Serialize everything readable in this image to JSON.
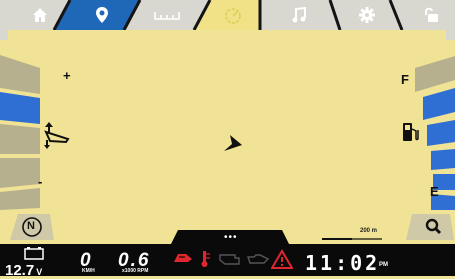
{
  "colors": {
    "map_bg": "#f1e395",
    "tab_active": "#1f67b7",
    "gauge_blue": "#2f6fd3",
    "gauge_gray": "#b7b08f",
    "bar_bg": "#0a0a0a",
    "warn_red": "#e0262f",
    "icon_yellow": "#d9cf56"
  },
  "nav": {
    "tabs": [
      {
        "icon": "home-icon",
        "active": false
      },
      {
        "icon": "location-pin-icon",
        "active": true
      },
      {
        "icon": "ruler-icon",
        "active": false
      },
      {
        "icon": "speedometer-icon",
        "active": false
      },
      {
        "icon": "music-note-icon",
        "active": false
      },
      {
        "icon": "gear-icon",
        "active": false
      },
      {
        "icon": "unlock-icon",
        "active": false
      }
    ]
  },
  "gauges": {
    "left": {
      "plus": "+",
      "minus": "-",
      "level_segments_lit": 1,
      "total_segments": 5
    },
    "right": {
      "full": "F",
      "empty": "E",
      "level_segments_lit": 5,
      "total_segments": 6
    }
  },
  "map": {
    "scale": "200 m",
    "compass": "N",
    "search_icon": "search-icon"
  },
  "status": {
    "voltage": "12.7",
    "voltage_unit": "V",
    "speed": "0",
    "speed_unit": "KM/H",
    "rpm": "0.6",
    "rpm_unit": "x1000 RPM",
    "time": "11:02",
    "ampm": "PM",
    "menu": "•••"
  }
}
